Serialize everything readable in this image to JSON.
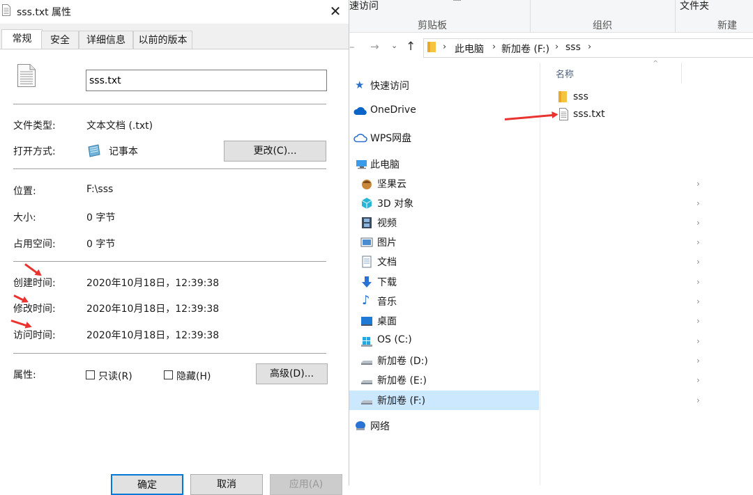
{
  "dialog": {
    "title": "sss.txt 属性",
    "close_glyph": "✕",
    "tabs": [
      {
        "label": "常规",
        "active": true
      },
      {
        "label": "安全",
        "active": false
      },
      {
        "label": "详细信息",
        "active": false
      },
      {
        "label": "以前的版本",
        "active": false
      }
    ],
    "file_name": "sss.txt",
    "file_icon": "text-document-icon",
    "file_type": {
      "label": "文件类型:",
      "value": "文本文档 (.txt)"
    },
    "opens_with": {
      "label": "打开方式:",
      "value": "记事本",
      "icon": "notepad-icon",
      "change_button": "更改(C)..."
    },
    "location": {
      "label": "位置:",
      "value": "F:\\sss"
    },
    "size": {
      "label": "大小:",
      "value": "0 字节"
    },
    "size_on_disk": {
      "label": "占用空间:",
      "value": "0 字节"
    },
    "created": {
      "label": "创建时间:",
      "value": "2020年10月18日，12:39:38"
    },
    "modified": {
      "label": "修改时间:",
      "value": "2020年10月18日，12:39:38"
    },
    "accessed": {
      "label": "访问时间:",
      "value": "2020年10月18日，12:39:38"
    },
    "attributes": {
      "label": "属性:",
      "readonly": "只读(R)",
      "hidden": "隐藏(H)",
      "advanced_button": "高级(D)..."
    },
    "footer": {
      "ok": "确定",
      "cancel": "取消",
      "apply": "应用(A)"
    },
    "annotation_color": "#e8332e"
  },
  "explorer": {
    "ribbon": {
      "quick_access_fragment": "速访问",
      "clipboard_group": "剪贴板",
      "organize_group": "组织",
      "new_folder": "文件夹",
      "new_group": "新建"
    },
    "breadcrumb": [
      "此电脑",
      "新加卷 (F:)",
      "sss"
    ],
    "nav": [
      {
        "label": "快速访问",
        "icon": "star-icon",
        "expandable": false
      },
      {
        "label": "OneDrive",
        "icon": "onedrive-cloud-icon",
        "expandable": false
      },
      {
        "label": "WPS网盘",
        "icon": "wps-cloud-icon",
        "expandable": false
      },
      {
        "label": "此电脑",
        "icon": "computer-icon",
        "expandable": false
      },
      {
        "label": "坚果云",
        "icon": "nutstore-icon",
        "expandable": true
      },
      {
        "label": "3D 对象",
        "icon": "3d-objects-icon",
        "expandable": true
      },
      {
        "label": "视频",
        "icon": "video-icon",
        "expandable": true
      },
      {
        "label": "图片",
        "icon": "pictures-icon",
        "expandable": true
      },
      {
        "label": "文档",
        "icon": "documents-icon",
        "expandable": true
      },
      {
        "label": "下载",
        "icon": "download-icon",
        "expandable": true
      },
      {
        "label": "音乐",
        "icon": "music-icon",
        "expandable": true
      },
      {
        "label": "桌面",
        "icon": "desktop-icon",
        "expandable": true
      },
      {
        "label": "OS (C:)",
        "icon": "os-drive-icon",
        "expandable": true
      },
      {
        "label": "新加卷 (D:)",
        "icon": "drive-icon",
        "expandable": true
      },
      {
        "label": "新加卷 (E:)",
        "icon": "drive-icon",
        "expandable": true
      },
      {
        "label": "新加卷 (F:)",
        "icon": "drive-icon",
        "expandable": true,
        "selected": true
      },
      {
        "label": "网络",
        "icon": "network-icon",
        "expandable": false
      }
    ],
    "column_header": "名称",
    "files": [
      {
        "name": "sss",
        "icon": "folder-icon"
      },
      {
        "name": "sss.txt",
        "icon": "text-file-icon"
      }
    ],
    "selected_color": "#cce8ff"
  }
}
